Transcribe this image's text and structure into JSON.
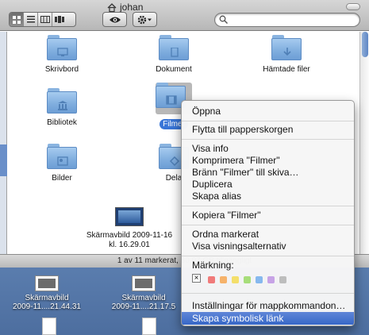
{
  "window": {
    "title": "johan",
    "view_modes": [
      "icon-view",
      "list-view",
      "column-view",
      "coverflow-view"
    ],
    "active_view": "icon-view",
    "search": {
      "value": "",
      "placeholder": ""
    }
  },
  "finder_items": [
    {
      "label": "Skrivbord",
      "icon": "desktop-folder-icon"
    },
    {
      "label": "Dokument",
      "icon": "documents-folder-icon"
    },
    {
      "label": "Hämtade filer",
      "icon": "downloads-folder-icon"
    },
    {
      "label": "Bibliotek",
      "icon": "library-folder-icon"
    },
    {
      "label": "Filmer",
      "icon": "movies-folder-icon",
      "selected": true
    },
    {
      "label": "Bilder",
      "icon": "pictures-folder-icon"
    },
    {
      "label": "Dela",
      "icon": "shared-folder-icon"
    }
  ],
  "screenshot_file": {
    "line1": "Skärmavbild 2009-11-16",
    "line2": "kl. 16.29.01"
  },
  "status": "1 av 11 markerat, 80,07 GB tillgängligt",
  "desktop_items": [
    {
      "line1": "Skärmavbild",
      "line2": "2009-11....21.44.31"
    },
    {
      "line1": "Skärmavbild",
      "line2": "2009-11....21.17.5"
    }
  ],
  "context_menu": {
    "open": "Öppna",
    "trash": "Flytta till papperskorgen",
    "get_info": "Visa info",
    "compress": "Komprimera \"Filmer\"",
    "burn": "Bränn \"Filmer\" till skiva…",
    "duplicate": "Duplicera",
    "alias": "Skapa alias",
    "copy": "Kopiera \"Filmer\"",
    "arrange": "Ordna markerat",
    "view_options": "Visa visningsalternativ",
    "label_heading": "Märkning:",
    "label_colors": [
      "#f07a7a",
      "#f6b26b",
      "#f4df6b",
      "#a7dd7a",
      "#86b8ee",
      "#c7a3e6",
      "#bdbdbd"
    ],
    "folder_actions": "Inställningar för mappkommandon…",
    "symlink": "Skapa symbolisk länk",
    "highlighted": "symlink"
  }
}
